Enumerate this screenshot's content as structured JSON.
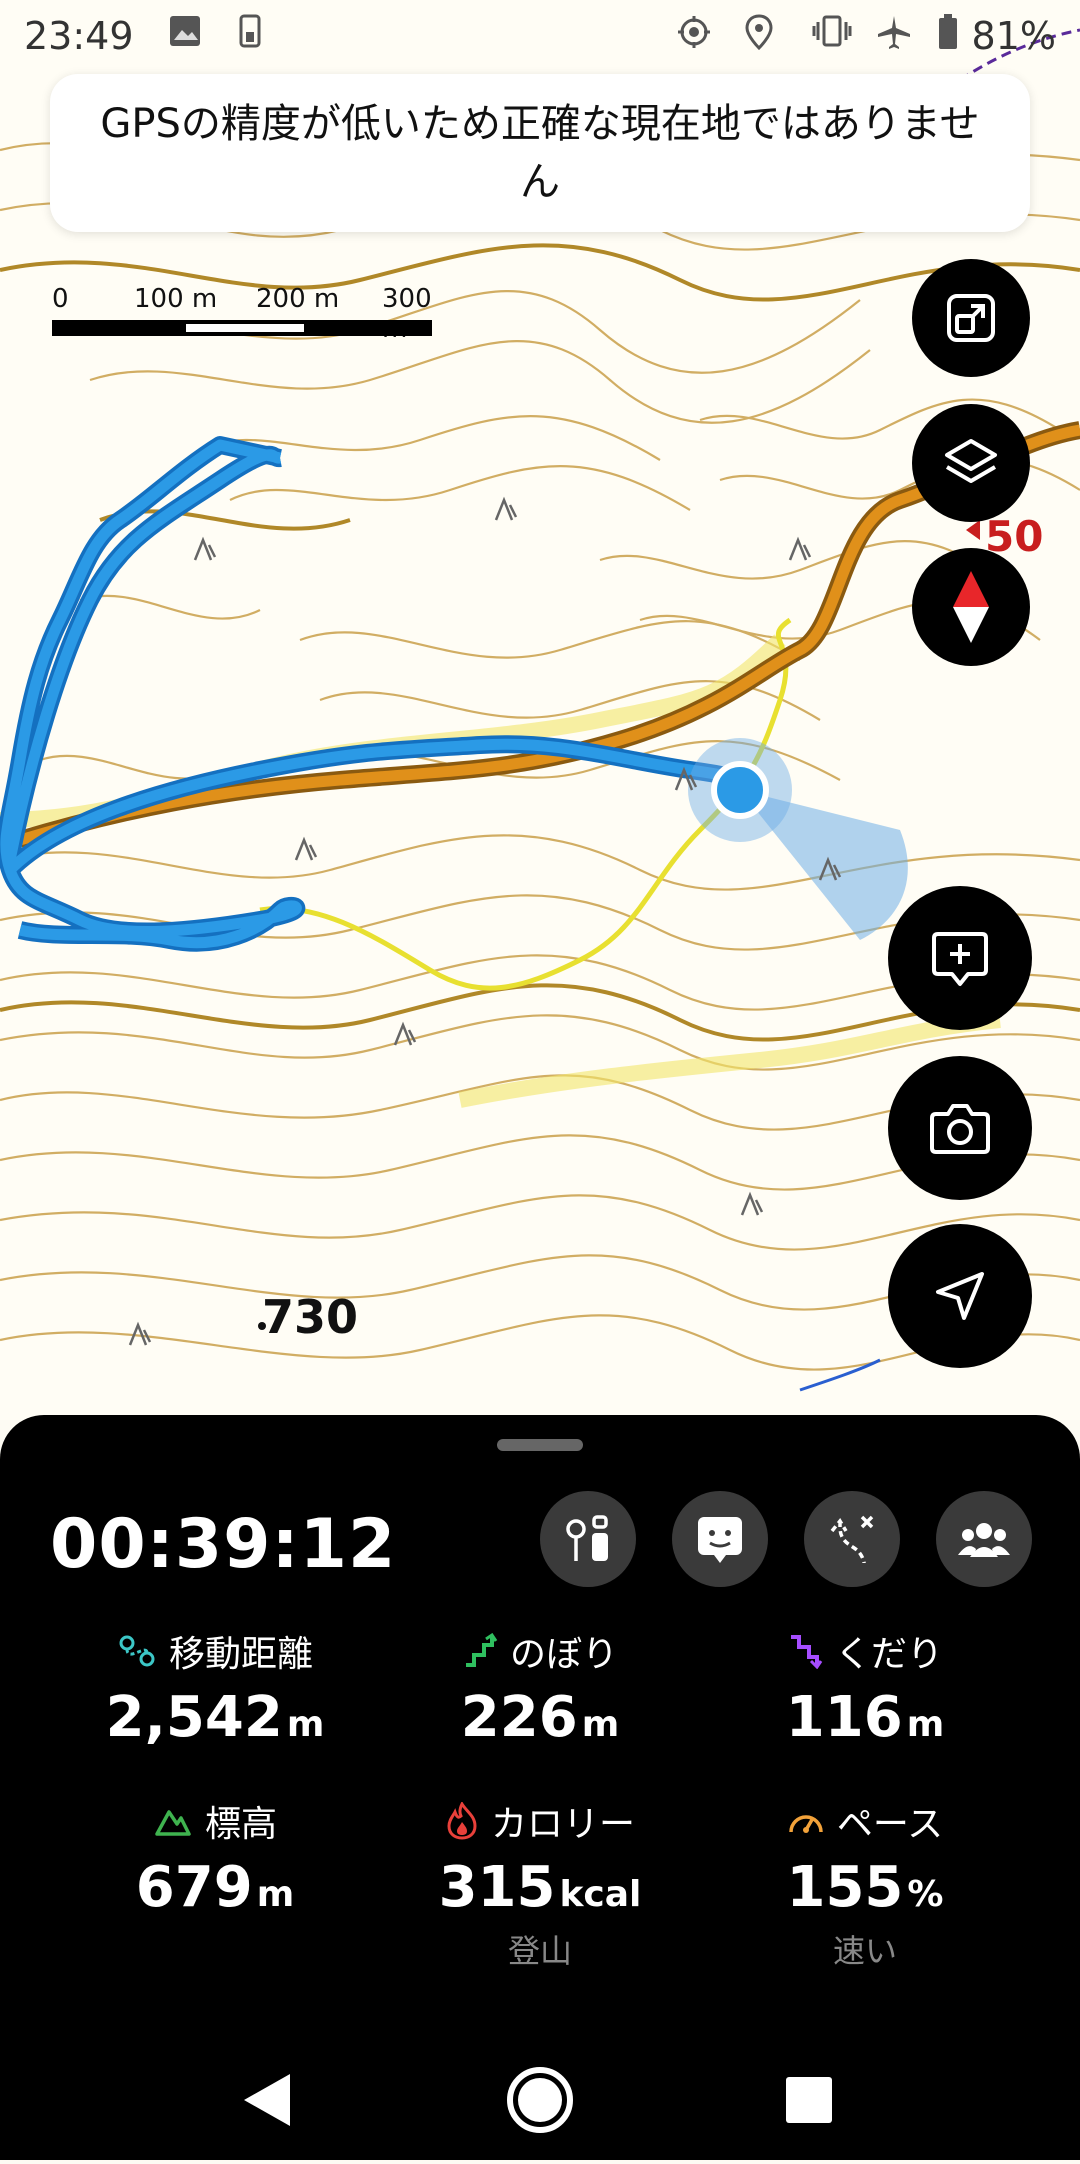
{
  "status_bar": {
    "time": "23:49",
    "battery": "81%"
  },
  "toast": {
    "message": "GPSの精度が低いため正確な現在地ではありません"
  },
  "scale_bar": {
    "labels": [
      "0",
      "100 m",
      "200 m",
      "300 m"
    ]
  },
  "map": {
    "peak_elevation": "730",
    "route_marker": "50"
  },
  "colors": {
    "track": "#2b8fe0",
    "road": "#d8870f",
    "trail": "#e8e030",
    "contour": "#c79a3a",
    "panel_bg": "#000000",
    "accent_distance": "#3cc7c7",
    "accent_up": "#2fbf5f",
    "accent_down": "#a64dff",
    "accent_elev": "#3fb34f",
    "accent_cal": "#e8403a",
    "accent_pace": "#f2a23a"
  },
  "panel": {
    "timer": "00:39:12",
    "tools": [
      "map-share-icon",
      "memo-icon",
      "route-icon",
      "group-icon"
    ],
    "stats": [
      {
        "label": "移動距離",
        "value": "2,542",
        "unit": "m",
        "sub": ""
      },
      {
        "label": "のぼり",
        "value": "226",
        "unit": "m",
        "sub": ""
      },
      {
        "label": "くだり",
        "value": "116",
        "unit": "m",
        "sub": ""
      },
      {
        "label": "標高",
        "value": "679",
        "unit": "m",
        "sub": ""
      },
      {
        "label": "カロリー",
        "value": "315",
        "unit": "kcal",
        "sub": "登山"
      },
      {
        "label": "ペース",
        "value": "155",
        "unit": "%",
        "sub": "速い"
      }
    ]
  }
}
